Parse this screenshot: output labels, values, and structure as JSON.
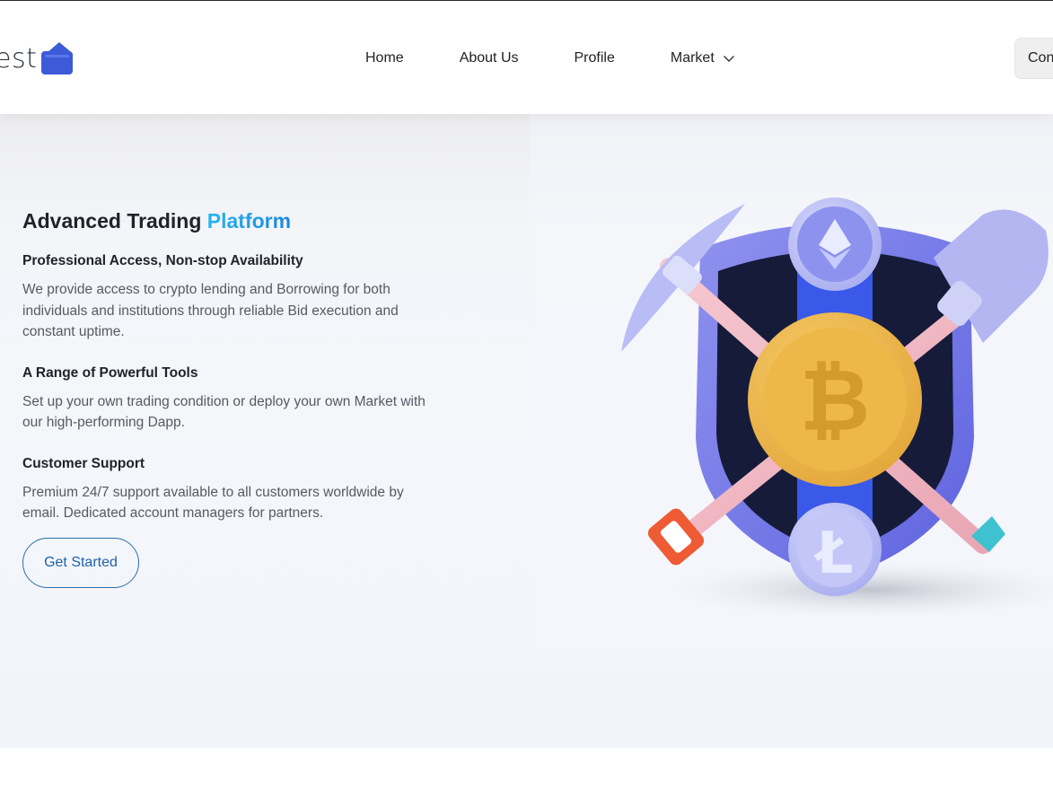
{
  "brand": {
    "logo_text": "est",
    "logo_icon": "wallet-icon",
    "accent_color": "#3d5bd9"
  },
  "nav": {
    "items": [
      {
        "label": "Home"
      },
      {
        "label": "About Us"
      },
      {
        "label": "Profile"
      },
      {
        "label": "Market",
        "icon": "chevron-down-icon"
      }
    ],
    "connect_label": "Con"
  },
  "hero": {
    "title_main": "Advanced Trading ",
    "title_accent": "Platform",
    "accent_color": "#1da1f2",
    "features": [
      {
        "title": "Professional Access, Non-stop Availability",
        "text": "We provide access to crypto lending and Borrowing for both individuals and institutions through reliable Bid execution and constant uptime."
      },
      {
        "title": "A Range of Powerful Tools",
        "text": "Set up your own trading condition or deploy your own Market with our high-performing Dapp."
      },
      {
        "title": "Customer Support",
        "text": "Premium 24/7 support available to all customers worldwide by email. Dedicated account managers for partners."
      }
    ],
    "cta_label": "Get Started",
    "illustration": "crypto-shield-illustration"
  }
}
